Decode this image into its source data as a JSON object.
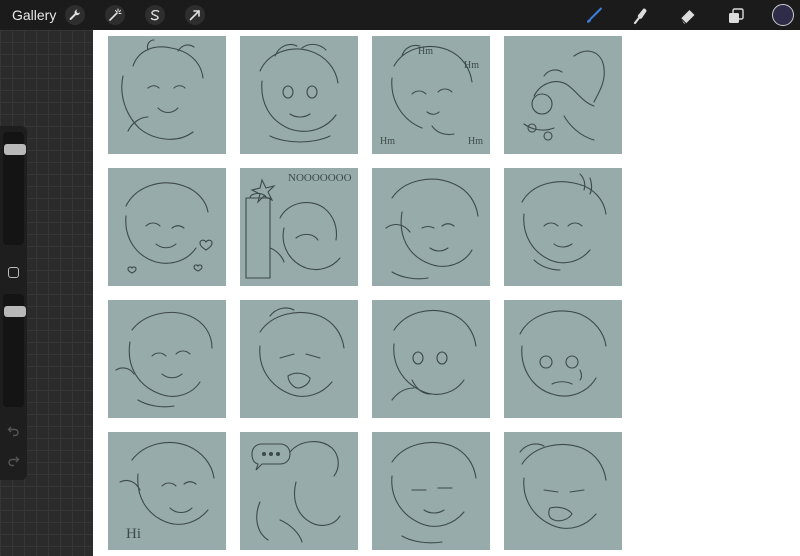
{
  "toolbar": {
    "gallery_label": "Gallery",
    "left_tools": [
      "wrench-icon",
      "magic-wand-icon",
      "selection-s-icon",
      "transform-arrow-icon"
    ],
    "right_tools": [
      "brush-icon",
      "smudge-icon",
      "eraser-icon",
      "layers-icon"
    ],
    "active_tool": "brush-icon",
    "active_color": "#3b7fd9",
    "current_color": "#2d2c49"
  },
  "sidebar": {
    "brush_size": 0.9,
    "opacity": 0.9,
    "undo_icon": "undo-icon",
    "redo_icon": "redo-icon"
  },
  "canvas": {
    "background": "#ffffff",
    "tile_color": "#97abab",
    "line_color": "#3e4a4a",
    "sketch_captions": {
      "tile_3": [
        "Hm",
        "Hm",
        "Hm",
        "Hm"
      ],
      "tile_6": "NOOOOOOO",
      "tile_13": "Hi"
    }
  }
}
